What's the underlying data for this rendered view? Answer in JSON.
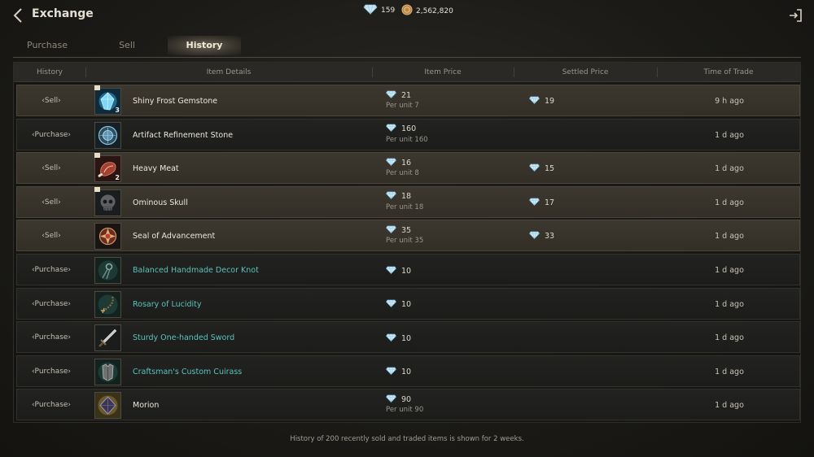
{
  "header": {
    "title": "Exchange",
    "gems": "159",
    "gold": "2,562,820"
  },
  "tabs": [
    {
      "label": "Purchase",
      "active": false
    },
    {
      "label": "Sell",
      "active": false
    },
    {
      "label": "History",
      "active": true
    }
  ],
  "table": {
    "columns": [
      "History",
      "Item Details",
      "Item Price",
      "Settled Price",
      "Time of Trade"
    ],
    "rows": [
      {
        "type": "‹Sell›",
        "kind": "sell",
        "icon": "frost-gemstone-icon",
        "qty": "3",
        "flag": true,
        "name": "Shiny Frost Gemstone",
        "name_color": "white",
        "price": "21",
        "per_unit": "Per unit  7",
        "settled": "19",
        "time": "9 h ago"
      },
      {
        "type": "‹Purchase›",
        "kind": "purchase",
        "icon": "refinement-stone-icon",
        "qty": "",
        "flag": false,
        "name": "Artifact Refinement Stone",
        "name_color": "white",
        "price": "160",
        "per_unit": "Per unit  160",
        "settled": "",
        "time": "1 d ago"
      },
      {
        "type": "‹Sell›",
        "kind": "sell",
        "icon": "meat-icon",
        "qty": "2",
        "flag": true,
        "name": "Heavy Meat",
        "name_color": "white",
        "price": "16",
        "per_unit": "Per unit  8",
        "settled": "15",
        "time": "1 d ago"
      },
      {
        "type": "‹Sell›",
        "kind": "sell",
        "icon": "skull-icon",
        "qty": "",
        "flag": true,
        "name": "Ominous Skull",
        "name_color": "white",
        "price": "18",
        "per_unit": "Per unit  18",
        "settled": "17",
        "time": "1 d ago"
      },
      {
        "type": "‹Sell›",
        "kind": "sell",
        "icon": "seal-icon",
        "qty": "",
        "flag": false,
        "name": "Seal of Advancement",
        "name_color": "white",
        "price": "35",
        "per_unit": "Per unit  35",
        "settled": "33",
        "time": "1 d ago"
      },
      {
        "type": "‹Purchase›",
        "kind": "purchase",
        "icon": "decor-knot-icon",
        "qty": "",
        "flag": false,
        "name": "Balanced Handmade Decor Knot",
        "name_color": "teal",
        "price": "10",
        "per_unit": "",
        "settled": "",
        "time": "1 d ago"
      },
      {
        "type": "‹Purchase›",
        "kind": "purchase",
        "icon": "rosary-icon",
        "qty": "",
        "flag": false,
        "name": "Rosary of Lucidity",
        "name_color": "teal",
        "price": "10",
        "per_unit": "",
        "settled": "",
        "time": "1 d ago"
      },
      {
        "type": "‹Purchase›",
        "kind": "purchase",
        "icon": "sword-icon",
        "qty": "",
        "flag": false,
        "name": "Sturdy One-handed Sword",
        "name_color": "teal",
        "price": "10",
        "per_unit": "",
        "settled": "",
        "time": "1 d ago"
      },
      {
        "type": "‹Purchase›",
        "kind": "purchase",
        "icon": "cuirass-icon",
        "qty": "",
        "flag": false,
        "name": "Craftsman's Custom Cuirass",
        "name_color": "teal",
        "price": "10",
        "per_unit": "",
        "settled": "",
        "time": "1 d ago"
      },
      {
        "type": "‹Purchase›",
        "kind": "purchase",
        "icon": "morion-icon",
        "qty": "",
        "flag": false,
        "name": "Morion",
        "name_color": "white",
        "price": "90",
        "per_unit": "Per unit  90",
        "settled": "",
        "time": "1 d ago"
      }
    ]
  },
  "footer": "History of 200 recently sold and traded items is shown for 2 weeks."
}
